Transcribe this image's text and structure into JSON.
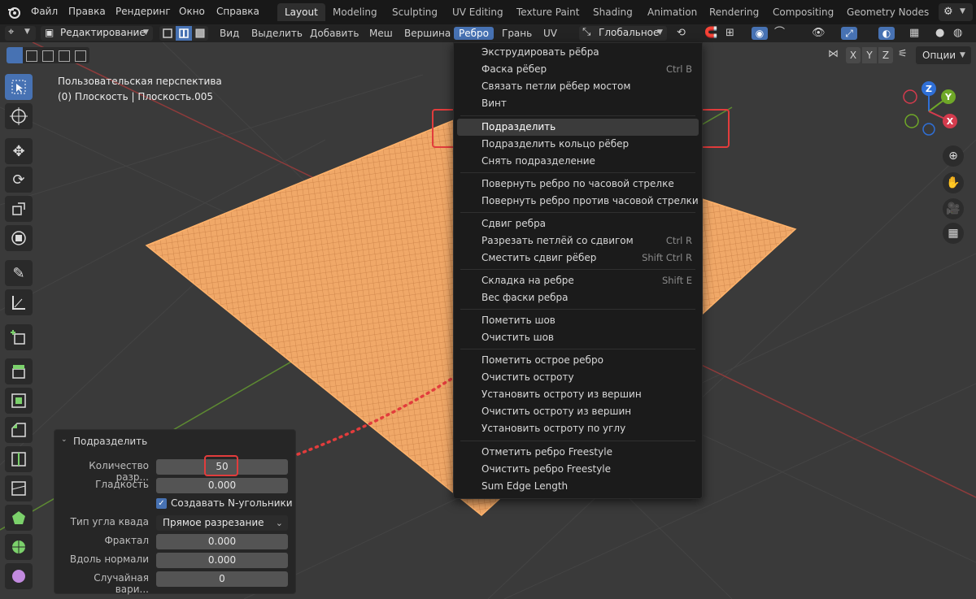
{
  "menubar": {
    "items": [
      "Файл",
      "Правка",
      "Рендеринг",
      "Окно",
      "Справка"
    ]
  },
  "workspace_tabs": [
    "Layout",
    "Modeling",
    "Sculpting",
    "UV Editing",
    "Texture Paint",
    "Shading",
    "Animation",
    "Rendering",
    "Compositing",
    "Geometry Nodes"
  ],
  "header": {
    "mode": "Редактирование",
    "menus": [
      "Вид",
      "Выделить",
      "Добавить",
      "Меш",
      "Вершина",
      "Ребро",
      "Грань",
      "UV"
    ],
    "active_menu": "Ребро",
    "transform_orientation": "Глобальное",
    "axes": [
      "X",
      "Y",
      "Z"
    ],
    "options_label": "Опции"
  },
  "viewport": {
    "perspective_label": "Пользовательская перспектива",
    "object_label": "(0) Плоскость | Плоскость.005",
    "gizmo_axes": [
      "Z",
      "Y",
      "X"
    ]
  },
  "edge_menu": {
    "items": [
      {
        "label": "Экструдировать рёбра",
        "shortcut": ""
      },
      {
        "label": "Фаска рёбер",
        "shortcut": "Ctrl B"
      },
      {
        "label": "Связать петли рёбер мостом",
        "shortcut": ""
      },
      {
        "label": "Винт",
        "shortcut": ""
      },
      {
        "label": "Подразделить",
        "shortcut": ""
      },
      {
        "label": "Подразделить кольцо рёбер",
        "shortcut": ""
      },
      {
        "label": "Снять подразделение",
        "shortcut": ""
      },
      {
        "label": "Повернуть ребро по часовой стрелке",
        "shortcut": ""
      },
      {
        "label": "Повернуть ребро против часовой стрелки",
        "shortcut": ""
      },
      {
        "label": "Сдвиг ребра",
        "shortcut": ""
      },
      {
        "label": "Разрезать петлёй со сдвигом",
        "shortcut": "Ctrl R"
      },
      {
        "label": "Сместить сдвиг рёбер",
        "shortcut": "Shift Ctrl R"
      },
      {
        "label": "Складка на ребре",
        "shortcut": "Shift E"
      },
      {
        "label": "Вес фаски ребра",
        "shortcut": ""
      },
      {
        "label": "Пометить шов",
        "shortcut": ""
      },
      {
        "label": "Очистить шов",
        "shortcut": ""
      },
      {
        "label": "Пометить острое ребро",
        "shortcut": ""
      },
      {
        "label": "Очистить остроту",
        "shortcut": ""
      },
      {
        "label": "Установить остроту из вершин",
        "shortcut": ""
      },
      {
        "label": "Очистить остроту из вершин",
        "shortcut": ""
      },
      {
        "label": "Установить остроту по углу",
        "shortcut": ""
      },
      {
        "label": "Отметить ребро Freestyle",
        "shortcut": ""
      },
      {
        "label": "Очистить ребро Freestyle",
        "shortcut": ""
      },
      {
        "label": "Sum Edge Length",
        "shortcut": ""
      }
    ],
    "highlighted": "Подразделить"
  },
  "operator_panel": {
    "title": "Подразделить",
    "rows": [
      {
        "label": "Количество разр...",
        "value": "50"
      },
      {
        "label": "Гладкость",
        "value": "0.000"
      },
      {
        "label": "Тип угла квада",
        "value": "Прямое разрезание"
      },
      {
        "label": "Фрактал",
        "value": "0.000"
      },
      {
        "label": "Вдоль нормали",
        "value": "0.000"
      },
      {
        "label": "Случайная вари...",
        "value": "0"
      }
    ],
    "checkbox": {
      "label": "Создавать N-угольники",
      "checked": true
    }
  },
  "colors": {
    "accent": "#4772b3",
    "mesh_orange": "#f0a868",
    "highlight_red": "#e23c3c"
  }
}
